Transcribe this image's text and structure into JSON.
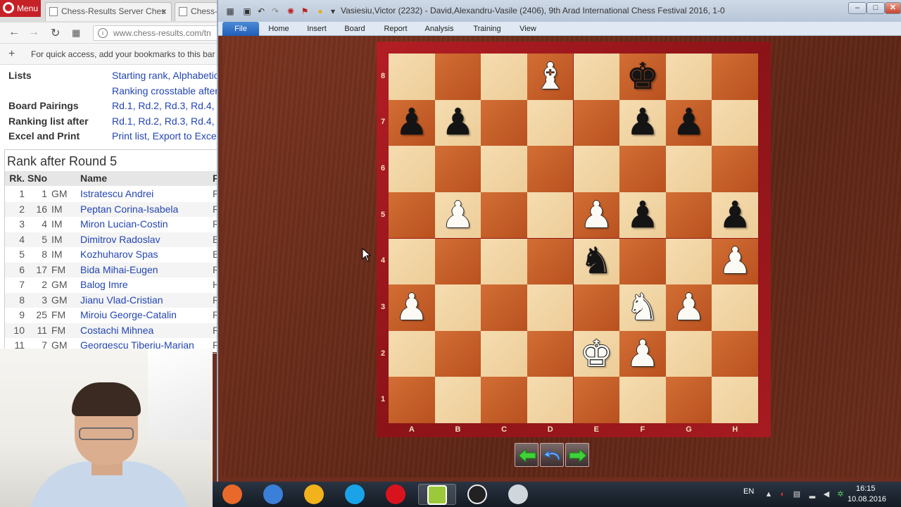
{
  "browser": {
    "menu_label": "Menu",
    "tabs": [
      {
        "label": "Chess-Results Server Ches"
      },
      {
        "label": "Chess-R"
      }
    ],
    "tab_close": "×",
    "url": "www.chess-results.com/tn",
    "bookmarks_hint": "For quick access, add your bookmarks to this bar",
    "menu_rows": [
      {
        "label": "Lists",
        "value": "Starting rank, Alphabetic"
      },
      {
        "label": "",
        "value": "Ranking crosstable after"
      },
      {
        "label": "Board Pairings",
        "value": "Rd.1, Rd.2, Rd.3, Rd.4, Rd"
      },
      {
        "label": "Ranking list after",
        "value": "Rd.1, Rd.2, Rd.3, Rd.4, Rd"
      },
      {
        "label": "Excel and Print",
        "value": "Print list, Export to Excel"
      }
    ],
    "ranking": {
      "title": "Rank after Round 5",
      "headers": {
        "rk": "Rk.",
        "sno": "SNo",
        "name": "Name",
        "fed": "F"
      },
      "rows": [
        {
          "rk": "1",
          "sno": "1",
          "title": "GM",
          "name": "Istratescu Andrei",
          "fed": "F"
        },
        {
          "rk": "2",
          "sno": "16",
          "title": "IM",
          "name": "Peptan Corina-Isabela",
          "fed": "R"
        },
        {
          "rk": "3",
          "sno": "4",
          "title": "IM",
          "name": "Miron Lucian-Costin",
          "fed": "R"
        },
        {
          "rk": "4",
          "sno": "5",
          "title": "IM",
          "name": "Dimitrov Radoslav",
          "fed": "B"
        },
        {
          "rk": "5",
          "sno": "8",
          "title": "IM",
          "name": "Kozhuharov Spas",
          "fed": "B"
        },
        {
          "rk": "6",
          "sno": "17",
          "title": "FM",
          "name": "Bida Mihai-Eugen",
          "fed": "R"
        },
        {
          "rk": "7",
          "sno": "2",
          "title": "GM",
          "name": "Balog Imre",
          "fed": "H"
        },
        {
          "rk": "8",
          "sno": "3",
          "title": "GM",
          "name": "Jianu Vlad-Cristian",
          "fed": "R"
        },
        {
          "rk": "9",
          "sno": "25",
          "title": "FM",
          "name": "Miroiu George-Catalin",
          "fed": "R"
        },
        {
          "rk": "10",
          "sno": "11",
          "title": "FM",
          "name": "Costachi Mihnea",
          "fed": "R"
        },
        {
          "rk": "11",
          "sno": "7",
          "title": "GM",
          "name": "Georgescu Tiberiu-Marian",
          "fed": "R"
        }
      ]
    }
  },
  "app": {
    "title": "Vasiesiu,Victor (2232) - David,Alexandru-Vasile (2406), 9th Arad International Chess Festival 2016, 1-0",
    "window_buttons": {
      "minimize": "–",
      "maximize": "□",
      "close": "✕"
    },
    "ribbon_tabs": [
      "File",
      "Home",
      "Insert",
      "Board",
      "Report",
      "Analysis",
      "Training",
      "View"
    ],
    "board": {
      "ranks": [
        "8",
        "7",
        "6",
        "5",
        "4",
        "3",
        "2",
        "1"
      ],
      "files": [
        "A",
        "B",
        "C",
        "D",
        "E",
        "F",
        "G",
        "H"
      ],
      "pieces": [
        {
          "square": "d8",
          "color": "w",
          "glyph": "♝",
          "name": "white-bishop"
        },
        {
          "square": "f8",
          "color": "b",
          "glyph": "♚",
          "name": "black-king"
        },
        {
          "square": "a7",
          "color": "b",
          "glyph": "♟",
          "name": "black-pawn"
        },
        {
          "square": "b7",
          "color": "b",
          "glyph": "♟",
          "name": "black-pawn"
        },
        {
          "square": "f7",
          "color": "b",
          "glyph": "♟",
          "name": "black-pawn"
        },
        {
          "square": "g7",
          "color": "b",
          "glyph": "♟",
          "name": "black-pawn"
        },
        {
          "square": "b5",
          "color": "w",
          "glyph": "♟",
          "name": "white-pawn"
        },
        {
          "square": "e5",
          "color": "w",
          "glyph": "♟",
          "name": "white-pawn"
        },
        {
          "square": "f5",
          "color": "b",
          "glyph": "♟",
          "name": "black-pawn"
        },
        {
          "square": "h5",
          "color": "b",
          "glyph": "♟",
          "name": "black-pawn"
        },
        {
          "square": "e4",
          "color": "b",
          "glyph": "♞",
          "name": "black-knight"
        },
        {
          "square": "h4",
          "color": "w",
          "glyph": "♟",
          "name": "white-pawn"
        },
        {
          "square": "a3",
          "color": "w",
          "glyph": "♟",
          "name": "white-pawn"
        },
        {
          "square": "f3",
          "color": "w",
          "glyph": "♞",
          "name": "white-knight"
        },
        {
          "square": "g3",
          "color": "w",
          "glyph": "♟",
          "name": "white-pawn"
        },
        {
          "square": "e2",
          "color": "w",
          "glyph": "♚",
          "name": "white-king"
        },
        {
          "square": "f2",
          "color": "w",
          "glyph": "♟",
          "name": "white-pawn"
        }
      ]
    },
    "nav_buttons": [
      {
        "name": "previous-move-button",
        "icon": "arrow-left-icon"
      },
      {
        "name": "takeback-button",
        "icon": "arrow-undo-icon"
      },
      {
        "name": "next-move-button",
        "icon": "arrow-right-icon"
      }
    ]
  },
  "taskbar": {
    "apps": [
      {
        "name": "firefox",
        "icon": "firefox-icon",
        "color": "#e8692a"
      },
      {
        "name": "app-blue",
        "icon": "blue-circle-icon",
        "color": "#3a7fd8"
      },
      {
        "name": "app-yellow",
        "icon": "yellow-circle-icon",
        "color": "#f2b21b"
      },
      {
        "name": "skype",
        "icon": "skype-icon",
        "color": "#1aa3e8"
      },
      {
        "name": "opera",
        "icon": "opera-icon",
        "color": "#d9131e"
      },
      {
        "name": "chessbase",
        "icon": "chessbase-12-icon",
        "color": "#9cc93b"
      },
      {
        "name": "obs",
        "icon": "obs-icon",
        "color": "#222222"
      },
      {
        "name": "app-grey",
        "icon": "grey-disc-icon",
        "color": "#cfd6dc"
      }
    ],
    "language": "EN",
    "time": "16:15",
    "date": "10.08.2016"
  },
  "colors": {
    "light_square": "#f0d4a4",
    "dark_square": "#c45f2a",
    "board_frame": "#a01a1f",
    "link_blue": "#2345b4"
  }
}
